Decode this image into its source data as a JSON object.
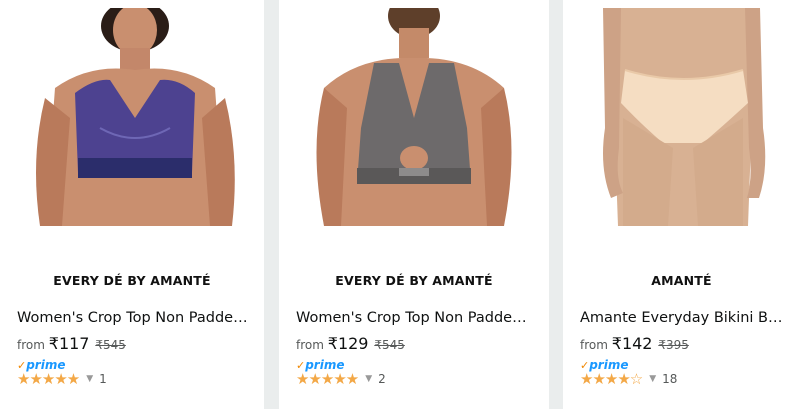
{
  "products": [
    {
      "brand": "EVERY DÉ BY AMANTÉ",
      "title": "Women's Crop Top Non Padded Non-Wired Sports Bra",
      "from_label": "from",
      "price": "₹117",
      "mrp": "₹545",
      "prime_label": "prime",
      "stars": "★★★★★",
      "rating": 5,
      "review_count": "1"
    },
    {
      "brand": "EVERY DÉ BY AMANTÉ",
      "title": "Women's Crop Top Non Padded Non-Wired Sports Bra",
      "from_label": "from",
      "price": "₹129",
      "mrp": "₹545",
      "prime_label": "prime",
      "stars": "★★★★★",
      "rating": 5,
      "review_count": "2"
    },
    {
      "brand": "AMANTÉ",
      "title": "Amante Everyday Bikini Brief",
      "from_label": "from",
      "price": "₹142",
      "mrp": "₹395",
      "prime_label": "prime",
      "stars": "★★★★",
      "stars_empty": "☆",
      "rating": 4,
      "review_count": "18"
    }
  ],
  "colors": {
    "star": "#f3a847",
    "prime_blue": "#1a98ff",
    "prime_check": "#f08804",
    "page_bg": "#eaeded"
  }
}
